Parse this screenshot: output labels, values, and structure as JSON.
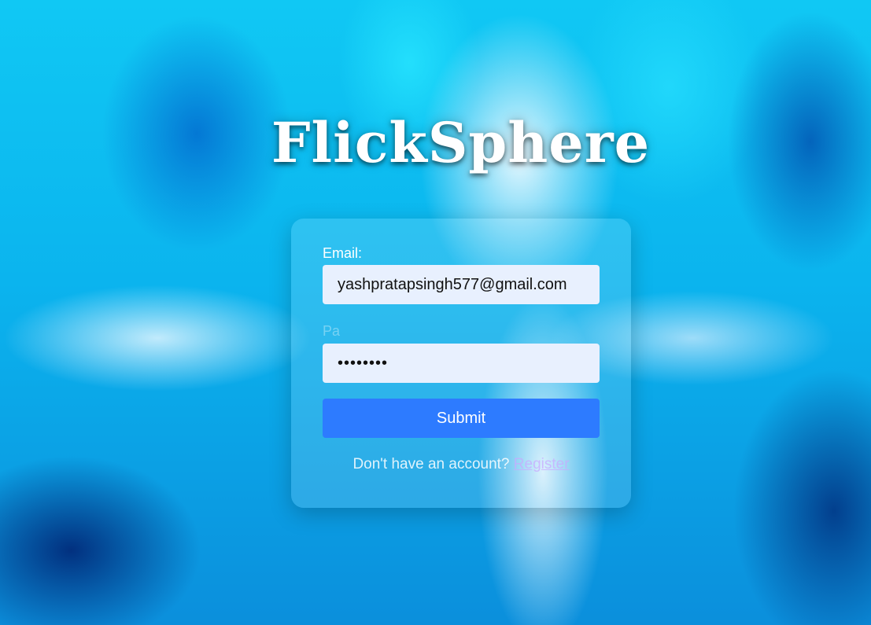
{
  "app": {
    "logo_text": "FlickSphere"
  },
  "form": {
    "email_label": "Email:",
    "email_value": "yashpratapsingh577@gmail.com",
    "password_label": "Pa",
    "password_value": "••••••••",
    "submit_label": "Submit",
    "footer_text": "Don't have an account?",
    "register_link": "Register"
  },
  "colors": {
    "primary_button": "#2d7bff",
    "input_background": "#e8f0fe",
    "text": "#ffffff"
  }
}
